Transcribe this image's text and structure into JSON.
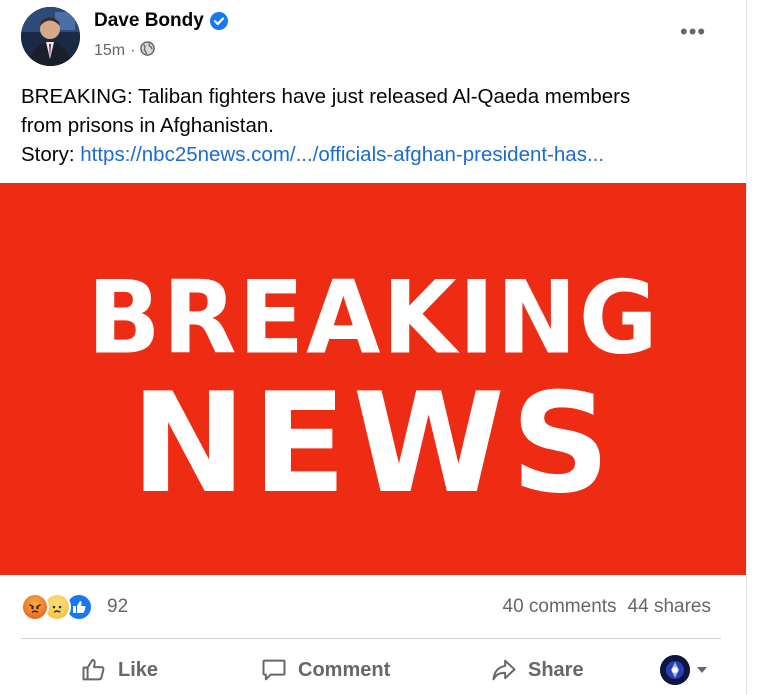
{
  "post": {
    "author": "Dave Bondy",
    "time": "15m",
    "separator": "·",
    "text_line1": "BREAKING: Taliban fighters have just released Al-Qaeda members",
    "text_line2": "from prisons in Afghanistan.",
    "story_label": "Story:",
    "story_link": "https://nbc25news.com/.../officials-afghan-president-has...",
    "more_label": "•••"
  },
  "media": {
    "line1": "BREAKING",
    "line2": "NEWS",
    "background_color": "#ee2b13"
  },
  "engagement": {
    "reaction_count": "92",
    "comments": "40 comments",
    "shares": "44 shares",
    "reaction_icons": [
      "angry-icon",
      "sad-icon",
      "like-icon"
    ]
  },
  "actions": {
    "like": "Like",
    "comment": "Comment",
    "share": "Share"
  },
  "colors": {
    "link": "#1b6bd1",
    "secondary_text": "#65676b",
    "verified": "#1877f2"
  }
}
